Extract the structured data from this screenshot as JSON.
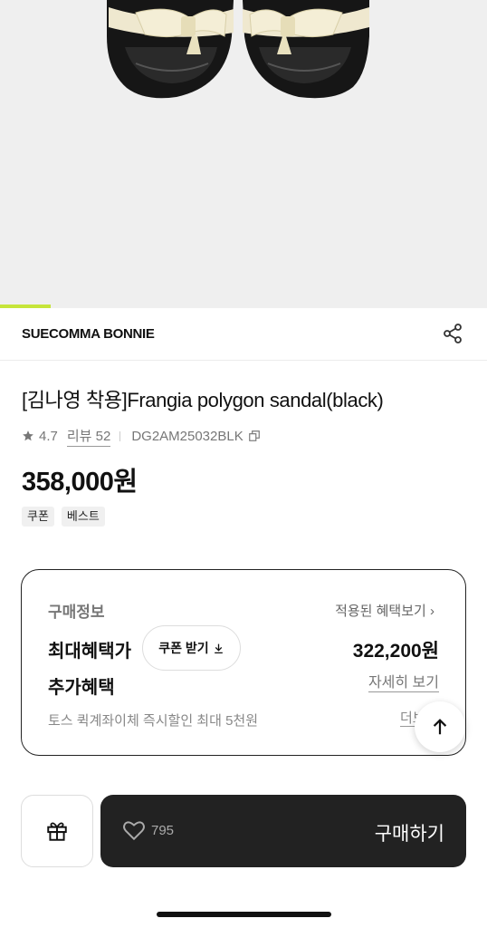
{
  "gallery": {
    "image": "product-photo-sandal-black-with-cream-bow",
    "progress": 0.105,
    "accent_color": "#c6e53a"
  },
  "brand": {
    "name": "SUECOMMA BONNIE",
    "share_icon": "share-icon"
  },
  "product": {
    "title": "[김나영 착용]Frangia polygon sandal(black)",
    "rating": "4.7",
    "reviews": "리뷰 52",
    "code": "DG2AM25032BLK",
    "price": "358,000원",
    "tags": [
      "쿠폰",
      "베스트"
    ]
  },
  "purchase_info": {
    "heading": "구매정보",
    "benefit_link": "적용된 혜택보기 ›",
    "max_label": "최대혜택가",
    "coupon_button": "쿠폰 받기",
    "max_price": "322,200원",
    "extra_label": "추가혜택",
    "detail_link": "자세히 보기",
    "toss_text": "토스 퀵계좌이체 즉시할인 최대 5천원",
    "more_link": "더보"
  },
  "bottom_bar": {
    "gift_icon": "gift-icon",
    "like_count": "795",
    "buy_label": "구매하기"
  }
}
